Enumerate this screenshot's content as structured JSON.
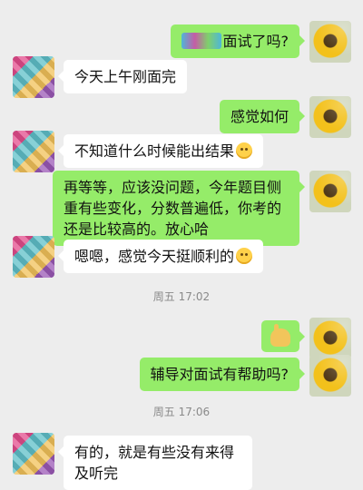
{
  "messages": [
    {
      "side": "out",
      "text": "面试了吗?",
      "obscured_prefix": true
    },
    {
      "side": "in",
      "text": "今天上午刚面完"
    },
    {
      "side": "out",
      "text": "感觉如何"
    },
    {
      "side": "in",
      "text": "不知道什么时候能出结果",
      "emoji": "smile-emoji"
    },
    {
      "side": "out",
      "text": "再等等，应该没问题，今年题目侧重有些变化，分数普遍低，你考的还是比较高的。放心哈"
    },
    {
      "side": "in",
      "text": "嗯嗯，感觉今天挺顺利的",
      "emoji": "smile-emoji"
    },
    {
      "side": "out",
      "emoji": "ok-hand-emoji"
    },
    {
      "side": "out",
      "text": "辅导对面试有帮助吗?"
    },
    {
      "side": "in",
      "text": "有的，就是有些没有来得及听完"
    }
  ],
  "timestamps": [
    "周五 17:02",
    "周五 17:06"
  ],
  "colors": {
    "background": "#ededed",
    "outgoing_bubble": "#95ec69",
    "incoming_bubble": "#ffffff"
  }
}
